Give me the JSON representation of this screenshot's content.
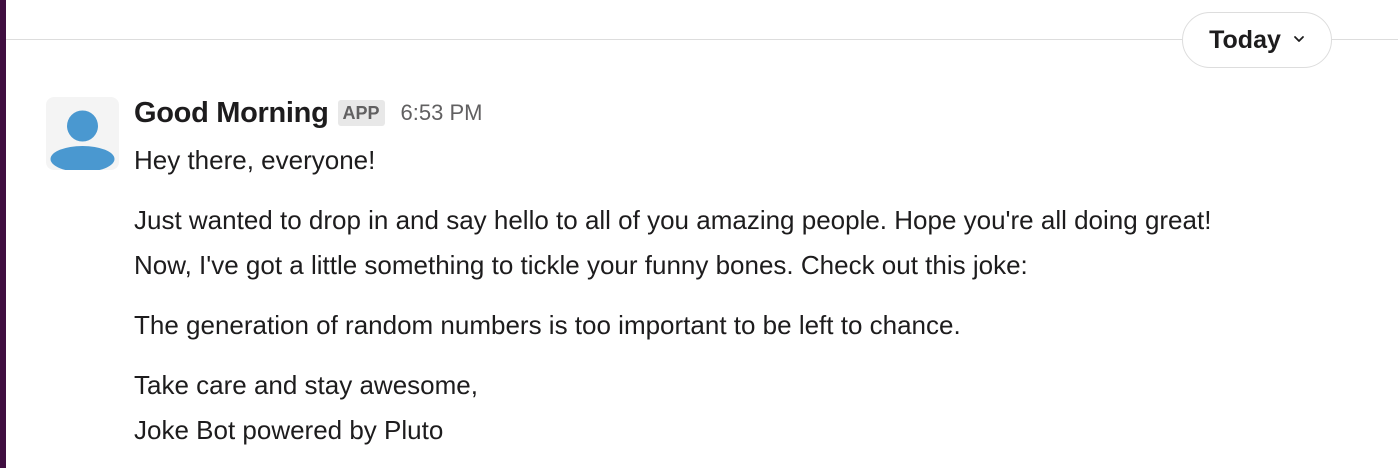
{
  "date_divider": {
    "label": "Today"
  },
  "message": {
    "sender": "Good Morning",
    "badge": "APP",
    "timestamp": "6:53 PM",
    "lines": [
      "Hey there, everyone!",
      "Just wanted to drop in and say hello to all of you amazing people. Hope you're all doing great!",
      "Now, I've got a little something to tickle your funny bones. Check out this joke:",
      "The generation of random numbers is too important to be left to chance.",
      "Take care and stay awesome,",
      "Joke Bot powered by Pluto"
    ]
  },
  "icons": {
    "avatar": "user-avatar-icon",
    "chevron": "chevron-down-icon"
  },
  "colors": {
    "avatar_fill": "#4a98d0",
    "sidebar_edge": "#3f0e40",
    "divider": "#dddddd"
  }
}
